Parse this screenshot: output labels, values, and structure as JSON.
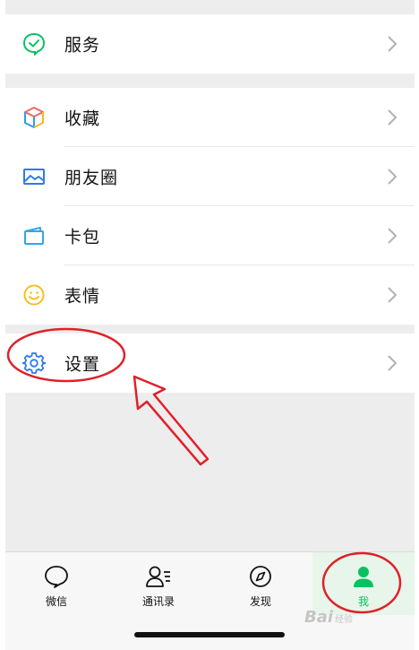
{
  "menu": {
    "service": {
      "label": "服务",
      "icon": "service-check-icon"
    },
    "collect": {
      "label": "收藏",
      "icon": "favorites-cube-icon"
    },
    "moments": {
      "label": "朋友圈",
      "icon": "moments-picture-icon"
    },
    "cards": {
      "label": "卡包",
      "icon": "card-wallet-icon"
    },
    "stickers": {
      "label": "表情",
      "icon": "smiley-icon"
    },
    "settings": {
      "label": "设置",
      "icon": "gear-icon"
    }
  },
  "tabbar": {
    "chats": {
      "label": "微信",
      "icon": "chat-bubble-icon"
    },
    "contacts": {
      "label": "通讯录",
      "icon": "contacts-icon"
    },
    "discover": {
      "label": "发现",
      "icon": "compass-icon"
    },
    "me": {
      "label": "我",
      "icon": "person-icon",
      "active": true
    }
  },
  "colors": {
    "accent": "#07c160",
    "annotation": "#e0202a",
    "background": "#ededed"
  },
  "watermark": {
    "text": "Bai",
    "suffix": "经验"
  }
}
